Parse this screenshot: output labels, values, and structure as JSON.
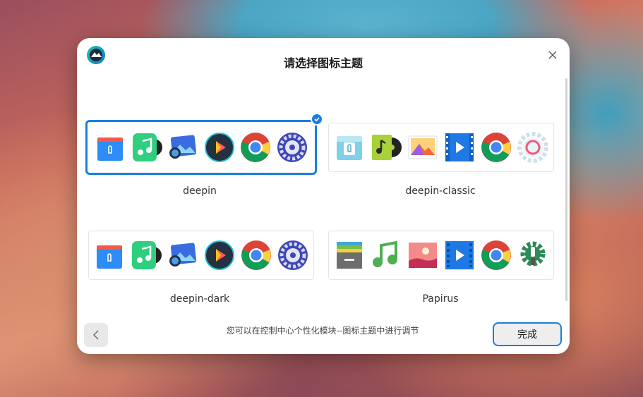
{
  "dialog": {
    "title": "请选择图标主题",
    "hint": "您可以在控制中心个性化模块--图标主题中进行调节",
    "done_label": "完成"
  },
  "themes": [
    {
      "name": "deepin",
      "selected": true,
      "icons": [
        "file-manager-icon",
        "music-icon",
        "image-viewer-icon",
        "video-player-icon",
        "chrome-icon",
        "settings-icon"
      ]
    },
    {
      "name": "deepin-classic",
      "selected": false,
      "icons": [
        "file-manager-icon",
        "music-icon",
        "image-viewer-icon",
        "video-player-icon",
        "chrome-icon",
        "settings-icon"
      ]
    },
    {
      "name": "deepin-dark",
      "selected": false,
      "icons": [
        "file-manager-icon",
        "music-icon",
        "image-viewer-icon",
        "video-player-icon",
        "chrome-icon",
        "settings-icon"
      ]
    },
    {
      "name": "Papirus",
      "selected": false,
      "icons": [
        "file-manager-icon",
        "music-icon",
        "image-viewer-icon",
        "video-player-icon",
        "chrome-icon",
        "settings-icon"
      ]
    }
  ],
  "colors": {
    "accent": "#1a7ee0"
  }
}
